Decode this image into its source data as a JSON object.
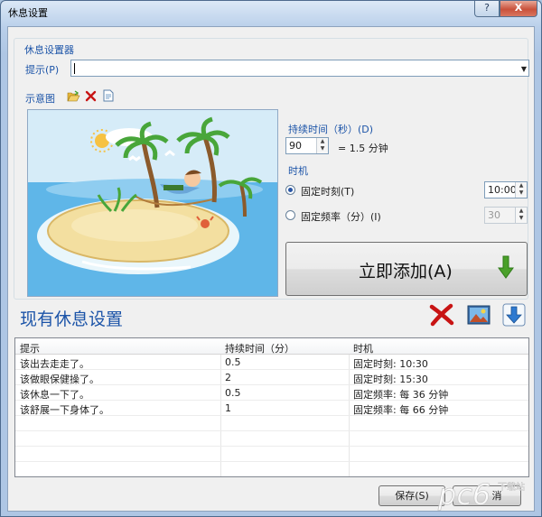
{
  "window": {
    "title": "休息设置",
    "help_glyph": "?",
    "close_glyph": "X"
  },
  "settings_group": {
    "title": "休息设置器"
  },
  "prompt": {
    "label": "提示(P)",
    "value": ""
  },
  "diagram": {
    "label": "示意图",
    "open_icon": "folder-open-icon",
    "delete_icon": "delete-x-icon",
    "preview_icon": "document-icon"
  },
  "duration": {
    "label": "持续时间（秒）(D)",
    "value": "90",
    "readout": "= 1.5 分钟"
  },
  "timing": {
    "label": "时机",
    "fixed_time_label": "固定时刻(T)",
    "fixed_time_value": "10:00",
    "fixed_freq_label": "固定频率（分）(I)",
    "fixed_freq_value": "30",
    "selected": "fixed_time"
  },
  "add_button": {
    "label": "立即添加(A)"
  },
  "existing": {
    "title": "现有休息设置"
  },
  "table": {
    "headers": [
      "提示",
      "持续时间（分）",
      "时机"
    ],
    "rows": [
      {
        "tip": "该出去走走了。",
        "duration": "0.5",
        "timing": "固定时刻: 10:30"
      },
      {
        "tip": "该做眼保健操了。",
        "duration": "2",
        "timing": "固定时刻: 15:30"
      },
      {
        "tip": "该休息一下了。",
        "duration": "0.5",
        "timing": "固定频率: 每 36 分钟"
      },
      {
        "tip": "该舒展一下身体了。",
        "duration": "1",
        "timing": "固定频率: 每 66 分钟"
      }
    ]
  },
  "footer": {
    "save_label": "保存(S)",
    "cancel_label": "消"
  },
  "watermark": {
    "text": "pc6",
    "sub": "下载站"
  },
  "colors": {
    "accent": "#1c54a8",
    "sea": "#5fb6e8",
    "sky": "#d6ecf8",
    "sand": "#f3dfa0",
    "green_arrow": "#4aa02a",
    "red_x": "#c81414"
  }
}
